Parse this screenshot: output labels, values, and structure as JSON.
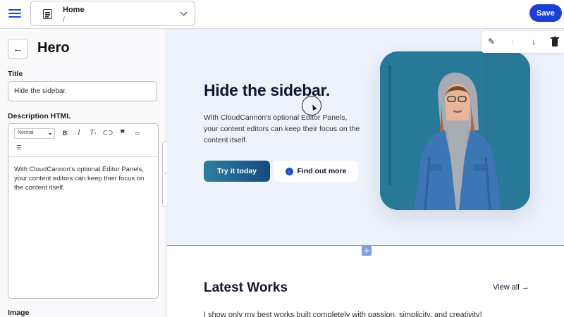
{
  "topbar": {
    "menu_icon": "hamburger-menu-icon",
    "page_select": {
      "title": "Home",
      "path": "/"
    },
    "save_label": "Save"
  },
  "sidebar": {
    "heading": "Hero",
    "title_label": "Title",
    "title_value": "Hide the sidebar.",
    "description_label": "Description HTML",
    "format_select": "Normal",
    "toolbar_buttons": [
      "B",
      "I",
      "Tx",
      "link",
      "quote",
      "ordered-list",
      "bullet-list"
    ],
    "description_value": "With CloudCannon's optional Editor Panels, your content editors can keep their focus on the content itself.",
    "image_label": "Image"
  },
  "preview": {
    "hero": {
      "heading": "Hide the sidebar.",
      "text": "With CloudCannon's optional Editor Panels, your content editors can keep their focus on the content itself.",
      "primary_button": "Try it today",
      "secondary_button": "Find out more"
    },
    "works": {
      "heading": "Latest Works",
      "view_all": "View all →",
      "description": "I show only my best works built completely with passion, simplicity, and creativity!"
    }
  }
}
